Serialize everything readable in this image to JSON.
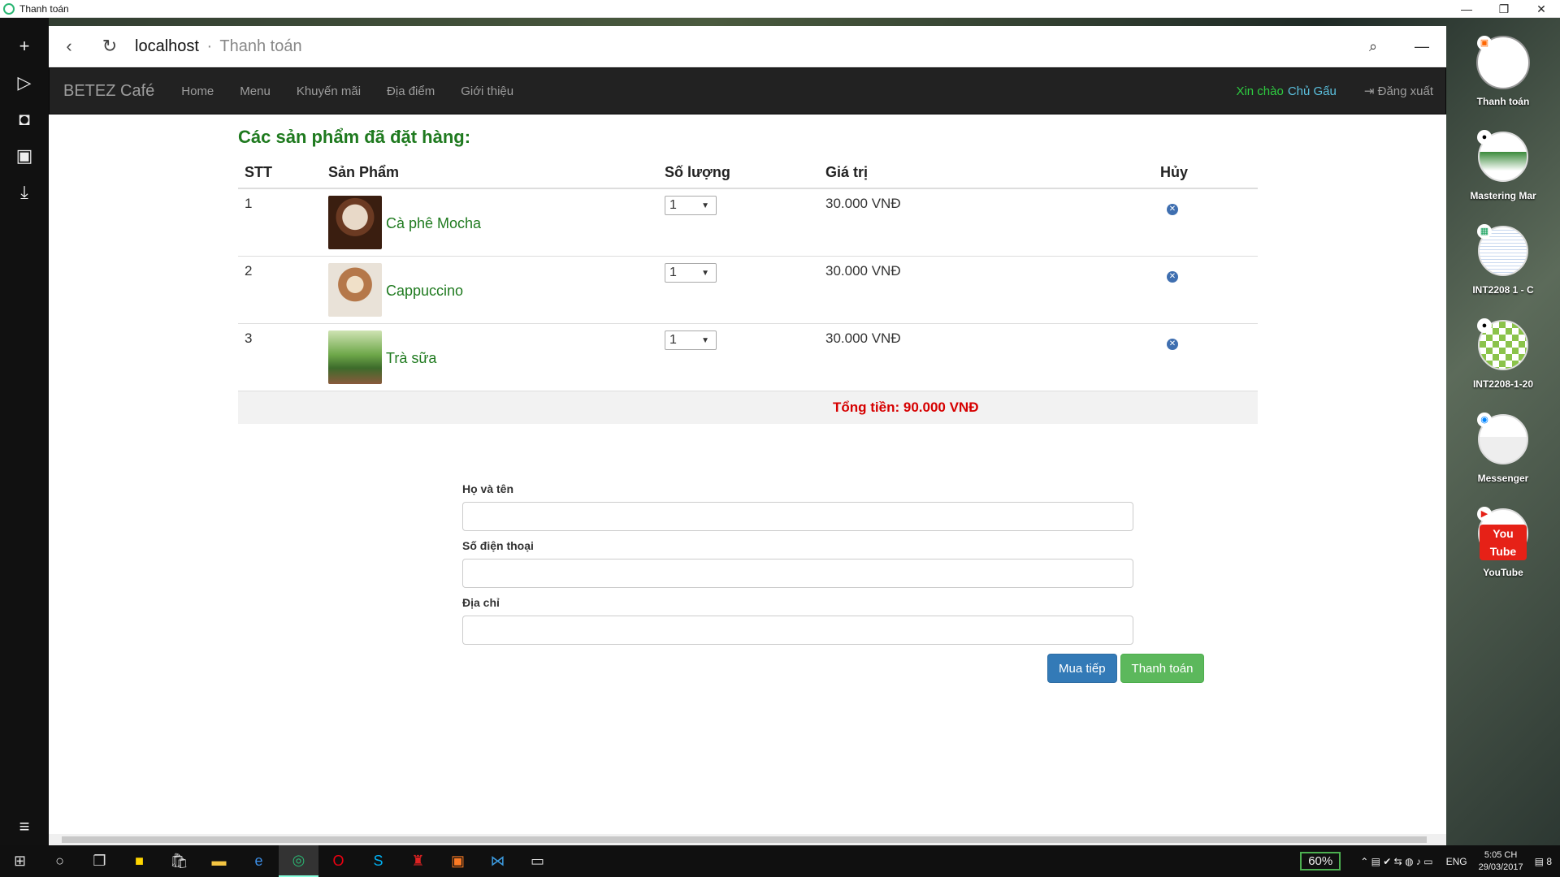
{
  "window": {
    "title": "Thanh toán",
    "controls": [
      "—",
      "❐",
      "✕"
    ]
  },
  "leftbar": {
    "icons": [
      "plus-icon",
      "play-icon",
      "camera-icon",
      "image-icon",
      "download-icon",
      "menu-icon"
    ]
  },
  "browser": {
    "host": "localhost",
    "separator": "·",
    "page_title": "Thanh toán"
  },
  "navbar": {
    "brand": "BETEZ Café",
    "links": [
      "Home",
      "Menu",
      "Khuyến mãi",
      "Địa điểm",
      "Giới thiệu"
    ],
    "greeting": "Xin chào",
    "username": "Chủ Gấu",
    "logout": "Đăng xuất"
  },
  "cart": {
    "heading": "Các sản phẩm đã đặt hàng:",
    "columns": [
      "STT",
      "Sản Phẩm",
      "Số lượng",
      "Giá trị",
      "Hủy"
    ],
    "rows": [
      {
        "stt": "1",
        "name": "Cà phê Mocha",
        "qty": "1",
        "price": "30.000 VNĐ"
      },
      {
        "stt": "2",
        "name": "Cappuccino",
        "qty": "1",
        "price": "30.000 VNĐ"
      },
      {
        "stt": "3",
        "name": "Trà sữa",
        "qty": "1",
        "price": "30.000 VNĐ"
      }
    ],
    "total": "Tổng tiền: 90.000 VNĐ"
  },
  "form": {
    "name_label": "Họ và tên",
    "phone_label": "Số điện thoại",
    "address_label": "Địa chỉ",
    "continue_button": "Mua tiếp",
    "checkout_button": "Thanh toán"
  },
  "shelf": [
    {
      "label": "Thanh toán"
    },
    {
      "label": "Mastering Mar"
    },
    {
      "label": "INT2208 1 - C"
    },
    {
      "label": "INT2208-1-20"
    },
    {
      "label": "Messenger"
    },
    {
      "label": "YouTube",
      "logo": "You Tube"
    }
  ],
  "taskbar": {
    "battery": "60%",
    "language": "ENG",
    "time": "5:05 CH",
    "date": "29/03/2017",
    "notifications": "8"
  }
}
